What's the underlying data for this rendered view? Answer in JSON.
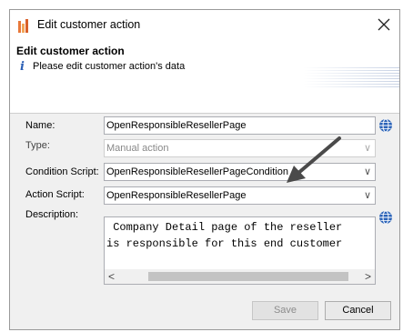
{
  "window": {
    "title": "Edit customer action",
    "close_glyph": "✕"
  },
  "header": {
    "title": "Edit customer action",
    "subtitle": "Please edit customer action's data",
    "info_icon": "i"
  },
  "form": {
    "name": {
      "label": "Name:",
      "value": "OpenResponsibleResellerPage"
    },
    "type": {
      "label": "Type:",
      "value": "Manual action"
    },
    "condition_script": {
      "label": "Condition Script:",
      "value": "OpenResponsibleResellerPageCondition"
    },
    "action_script": {
      "label": "Action Script:",
      "value": "OpenResponsibleResellerPage"
    },
    "description": {
      "label": "Description:",
      "line1": " Company Detail page of the reseller",
      "line2": "is responsible for this end customer"
    }
  },
  "scroll": {
    "left": "<",
    "right": ">"
  },
  "buttons": {
    "save": "Save",
    "cancel": "Cancel"
  },
  "icons": {
    "chevron": "∨"
  },
  "colors": {
    "annotation_arrow": "#4a4a4a",
    "globe": "#2b63b8"
  }
}
